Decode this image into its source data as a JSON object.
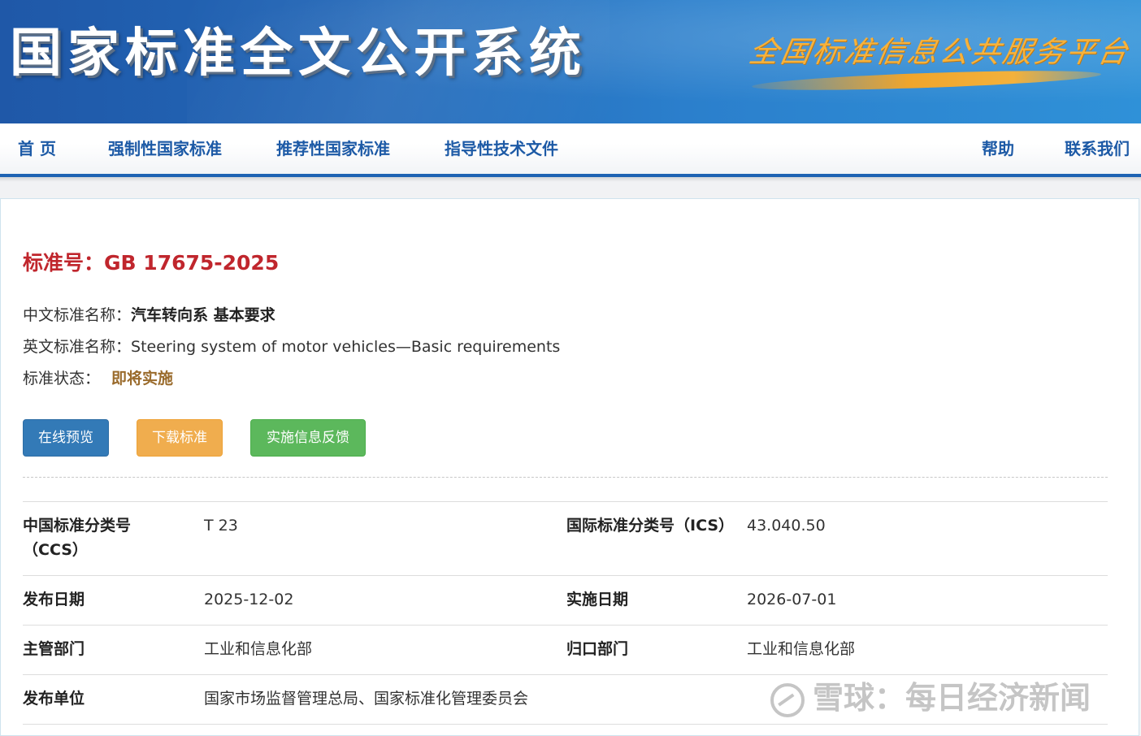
{
  "header": {
    "site_title": "国家标准全文公开系统",
    "slogan": "全国标准信息公共服务平台"
  },
  "nav": {
    "items": [
      {
        "label": "首 页"
      },
      {
        "label": "强制性国家标准"
      },
      {
        "label": "推荐性国家标准"
      },
      {
        "label": "指导性技术文件"
      },
      {
        "label": "帮助"
      },
      {
        "label": "联系我们"
      }
    ]
  },
  "standard": {
    "number_label": "标准号：",
    "number": "GB 17675-2025",
    "cn_name_label": "中文标准名称：",
    "cn_name": "汽车转向系 基本要求",
    "en_name_label": "英文标准名称：",
    "en_name": "Steering system of motor vehicles—Basic requirements",
    "status_label": "标准状态：",
    "status": "即将实施"
  },
  "buttons": {
    "preview": "在线预览",
    "download": "下载标准",
    "feedback": "实施信息反馈"
  },
  "details": {
    "ccs_label_line1": "中国标准分类号",
    "ccs_label_line2": "（CCS）",
    "ccs": "T 23",
    "ics_label": "国际标准分类号（ICS）",
    "ics": "43.040.50",
    "publish_date_label": "发布日期",
    "publish_date": "2025-12-02",
    "impl_date_label": "实施日期",
    "impl_date": "2026-07-01",
    "competent_dept_label": "主管部门",
    "competent_dept": "工业和信息化部",
    "owner_dept_label": "归口部门",
    "owner_dept": "工业和信息化部",
    "publisher_label": "发布单位",
    "publisher": "国家市场监督管理总局、国家标准化管理委员会"
  },
  "watermark": {
    "text": "雪球：每日经济新闻",
    "icon": "xueqiu-logo-icon"
  },
  "colors": {
    "nav_text": "#1d5aa6",
    "standard_number": "#c0262d",
    "status_text": "#9a6b2c",
    "btn_preview": "#337ab7",
    "btn_download": "#f0ad4e",
    "btn_feedback": "#5cb85c"
  }
}
